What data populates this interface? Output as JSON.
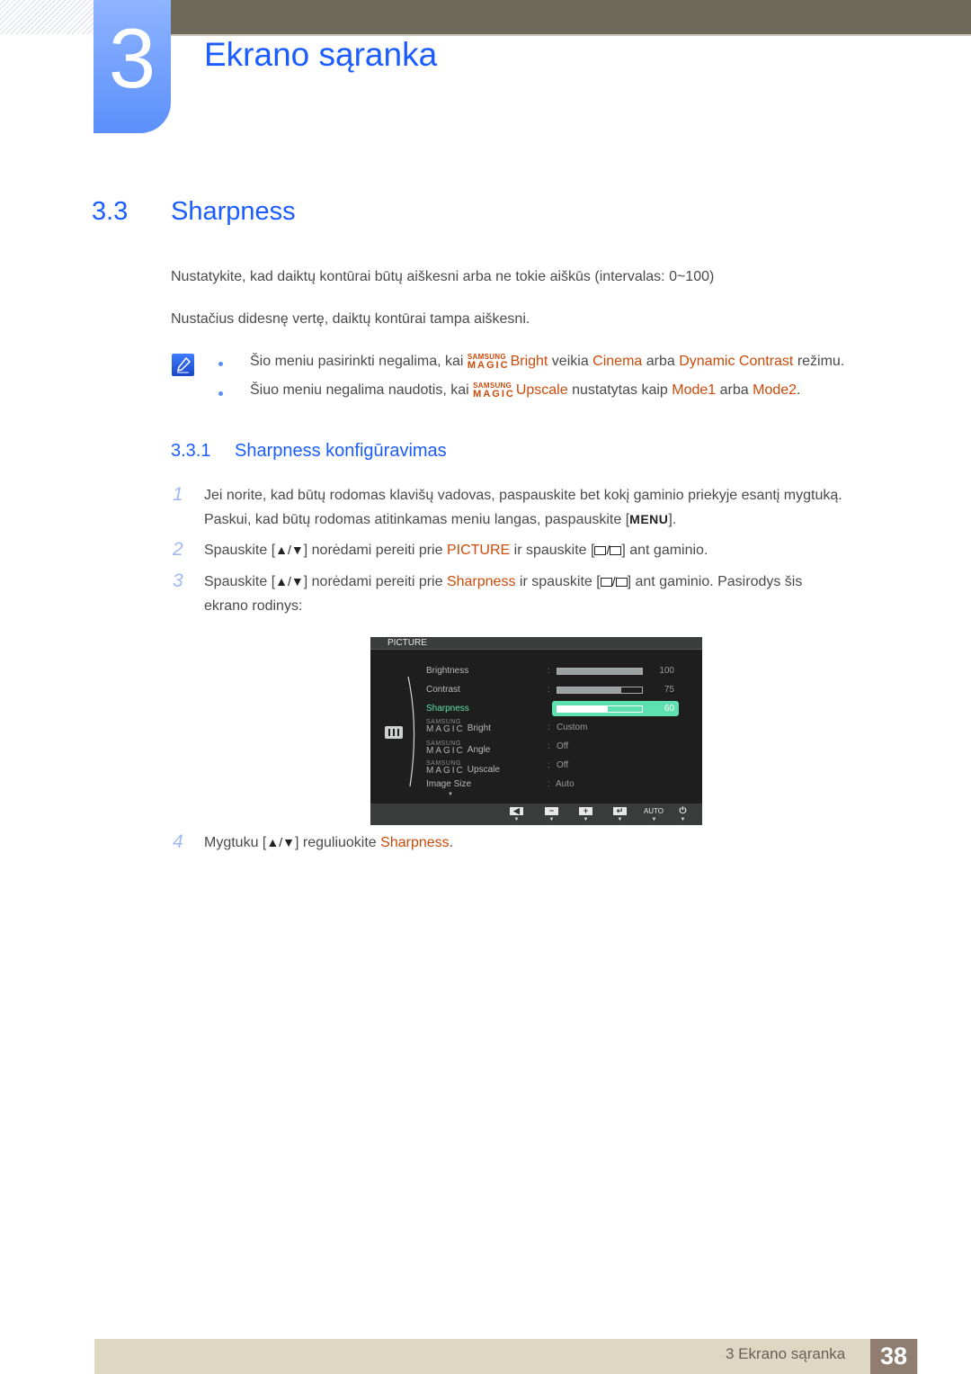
{
  "chapter": {
    "number": "3",
    "title": "Ekrano sąranka"
  },
  "section": {
    "number": "3.3",
    "title": "Sharpness",
    "paragraphs": [
      "Nustatykite, kad daiktų kontūrai būtų aiškesni arba ne tokie aiškūs (intervalas: 0~100)",
      "Nustačius didesnę vertę, daiktų kontūrai tampa aiškesni."
    ]
  },
  "notes": [
    {
      "prefix": "Šio meniu pasirinkti negalima, kai ",
      "magic_top": "SAMSUNG",
      "magic_bottom": "MAGIC",
      "feature": "Bright",
      "mid1": " veikia ",
      "hl1": "Cinema",
      "mid2": " arba ",
      "hl2": "Dynamic Contrast",
      "suffix": " režimu."
    },
    {
      "prefix": "Šiuo meniu negalima naudotis, kai ",
      "magic_top": "SAMSUNG",
      "magic_bottom": "MAGIC",
      "feature": "Upscale",
      "mid1": " nustatytas kaip ",
      "hl1": "Mode1",
      "mid2": " arba ",
      "hl2": "Mode2",
      "suffix": "."
    }
  ],
  "subsection": {
    "number": "3.3.1",
    "title": "Sharpness konfigūravimas"
  },
  "steps": [
    {
      "num": "1",
      "line1": "Jei norite, kad būtų rodomas klavišų vadovas, paspauskite bet kokį gaminio priekyje esantį mygtuką.",
      "line2_prefix": "Paskui, kad būtų rodomas atitinkamas meniu langas, paspauskite [",
      "key": "MENU",
      "line2_suffix": "]."
    },
    {
      "num": "2",
      "prefix": "Spauskite [",
      "arrows": "▲/▼",
      "mid": "] norėdami pereiti prie ",
      "target": "PICTURE",
      "mid2": " ir spauskite [",
      "slash": "/",
      "suffix": "] ant gaminio."
    },
    {
      "num": "3",
      "prefix": "Spauskite [",
      "arrows": "▲/▼",
      "mid": "] norėdami pereiti prie ",
      "target": "Sharpness",
      "mid2": " ir spauskite [",
      "slash": "/",
      "suffix": "] ant gaminio. Pasirodys šis",
      "line2": "ekrano rodinys:"
    },
    {
      "num": "4",
      "prefix": "Mygtuku [",
      "arrows": "▲/▼",
      "mid": "] reguliuokite ",
      "target": "Sharpness",
      "suffix": "."
    }
  ],
  "osd": {
    "title": "PICTURE",
    "items": [
      {
        "label": "Brightness",
        "type": "bar",
        "value": "100",
        "fraction": 1.0
      },
      {
        "label": "Contrast",
        "type": "bar",
        "value": "75",
        "fraction": 0.75
      },
      {
        "label": "Sharpness",
        "type": "bar",
        "value": "60",
        "fraction": 0.6,
        "selected": true
      },
      {
        "magic_top": "SAMSUNG",
        "magic_bottom": "MAGIC",
        "label": "Bright",
        "type": "text",
        "value": "Custom"
      },
      {
        "magic_top": "SAMSUNG",
        "magic_bottom": "MAGIC",
        "label": "Angle",
        "type": "text",
        "value": "Off"
      },
      {
        "magic_top": "SAMSUNG",
        "magic_bottom": "MAGIC",
        "label": "Upscale",
        "type": "text",
        "value": "Off"
      },
      {
        "label": "Image Size",
        "type": "text",
        "value": "Auto"
      }
    ],
    "more_indicator": "▼",
    "colon": ":",
    "buttons": [
      {
        "icon": "left-arrow-icon",
        "glyph": "◀"
      },
      {
        "icon": "minus-icon",
        "glyph": "−"
      },
      {
        "icon": "plus-icon",
        "glyph": "+"
      },
      {
        "icon": "enter-icon",
        "glyph": "↵"
      },
      {
        "icon": "auto-icon",
        "glyph": "AUTO"
      },
      {
        "icon": "power-icon",
        "glyph": "⏻"
      }
    ],
    "button_arrow": "▼",
    "colors": {
      "selected": "#5fe0b0",
      "selected_text": "#5fe0b0"
    }
  },
  "footer": {
    "text": "3 Ekrano sąranka",
    "page": "38"
  }
}
